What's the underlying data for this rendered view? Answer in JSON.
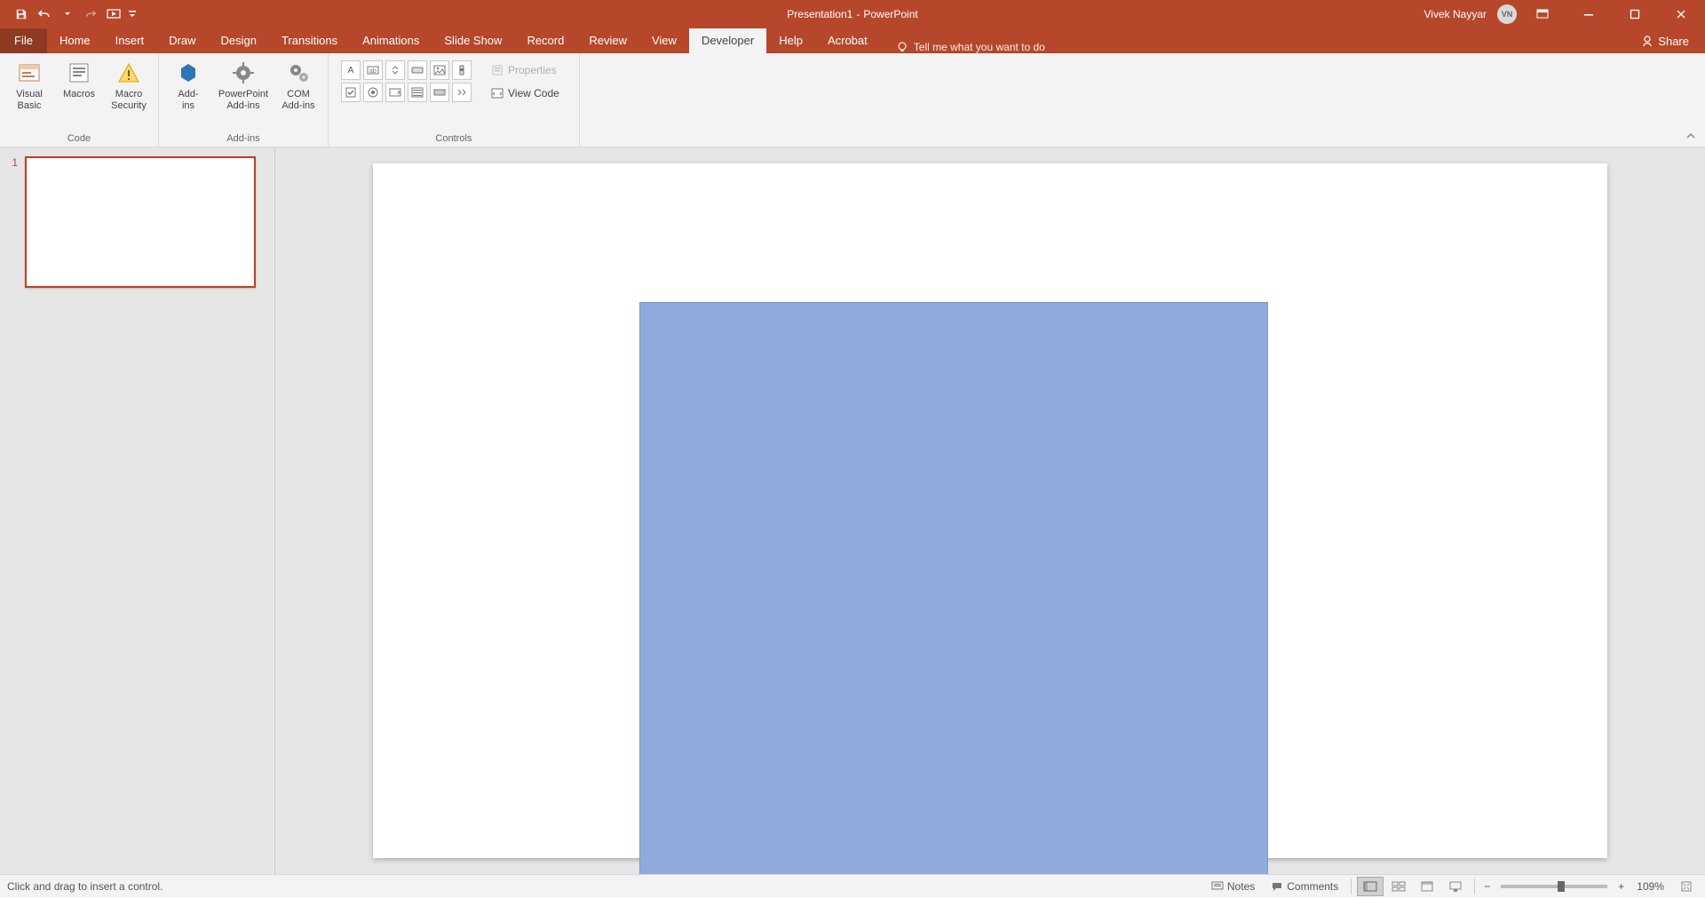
{
  "title": {
    "doc": "Presentation1",
    "sep": "  -  ",
    "app": "PowerPoint"
  },
  "user": {
    "name": "Vivek Nayyar",
    "initials": "VN"
  },
  "qat": [
    "save",
    "undo",
    "redo",
    "start-from-beginning"
  ],
  "tabs": {
    "file": "File",
    "items": [
      "Home",
      "Insert",
      "Draw",
      "Design",
      "Transitions",
      "Animations",
      "Slide Show",
      "Record",
      "Review",
      "View",
      "Developer",
      "Help",
      "Acrobat"
    ],
    "active": "Developer",
    "tellme": "Tell me what you want to do",
    "share": "Share"
  },
  "ribbon": {
    "groups": {
      "code": {
        "label": "Code",
        "buttons": {
          "vb": "Visual\nBasic",
          "macros": "Macros",
          "security": "Macro\nSecurity"
        }
      },
      "addins": {
        "label": "Add-ins",
        "buttons": {
          "addins": "Add-\nins",
          "ppaddins": "PowerPoint\nAdd-ins",
          "comaddins": "COM\nAdd-ins"
        }
      },
      "controls": {
        "label": "Controls",
        "props": "Properties",
        "viewcode": "View Code"
      }
    }
  },
  "thumbs": {
    "slide1": "1"
  },
  "status": {
    "left": "Click and drag to insert a control.",
    "notes": "Notes",
    "comments": "Comments",
    "zoom": "109%"
  }
}
